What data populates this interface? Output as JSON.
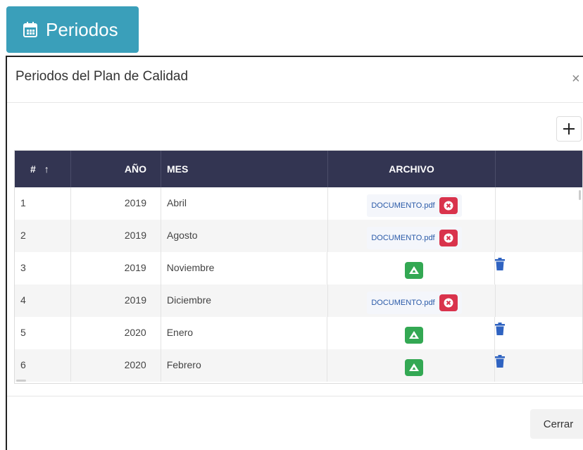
{
  "top_button": {
    "label": "Periodos",
    "icon": "calendar-icon"
  },
  "modal": {
    "title": "Periodos del Plan de Calidad",
    "close_symbol": "×",
    "add_symbol": "+",
    "footer_close_label": "Cerrar"
  },
  "table": {
    "headers": {
      "num": "#",
      "sort_arrow": "↑",
      "year": "AÑO",
      "month": "MES",
      "file": "ARCHIVO",
      "actions": ""
    },
    "rows": [
      {
        "num": "1",
        "year": "2019",
        "month": "Abril",
        "file": "DOCUMENTO.pdf",
        "has_file": true,
        "deletable": false
      },
      {
        "num": "2",
        "year": "2019",
        "month": "Agosto",
        "file": "DOCUMENTO.pdf",
        "has_file": true,
        "deletable": false
      },
      {
        "num": "3",
        "year": "2019",
        "month": "Noviembre",
        "file": "",
        "has_file": false,
        "deletable": true
      },
      {
        "num": "4",
        "year": "2019",
        "month": "Diciembre",
        "file": "DOCUMENTO.pdf",
        "has_file": true,
        "deletable": false
      },
      {
        "num": "5",
        "year": "2020",
        "month": "Enero",
        "file": "",
        "has_file": false,
        "deletable": true
      },
      {
        "num": "6",
        "year": "2020",
        "month": "Febrero",
        "file": "",
        "has_file": false,
        "deletable": true
      }
    ]
  },
  "colors": {
    "header_bg": "#333552",
    "primary_btn": "#3a9fba",
    "danger": "#d9334c",
    "drive": "#33a853",
    "trash": "#2f63c1"
  }
}
